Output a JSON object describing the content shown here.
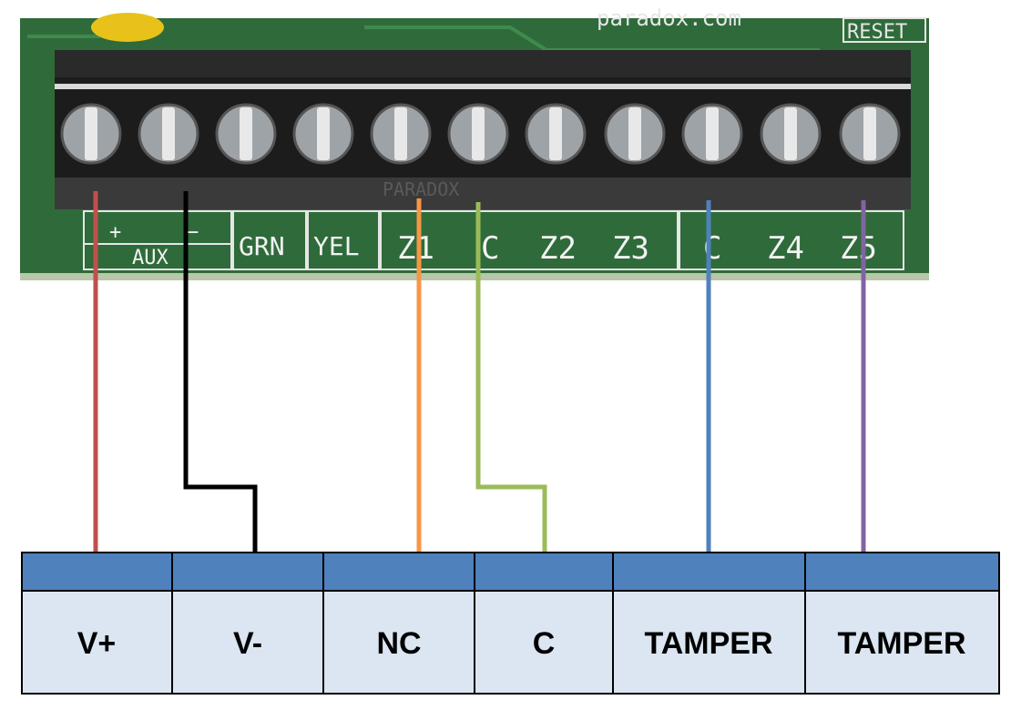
{
  "board": {
    "url_text": "paradox.com",
    "reset_text": "RESET",
    "brand_text": "PARADOX",
    "aux_text": "AUX",
    "aux_plus": "+",
    "aux_minus": "−",
    "terminal_labels": [
      "GRN",
      "YEL",
      "Z1",
      "C",
      "Z2",
      "Z3",
      "C",
      "Z4",
      "Z5"
    ],
    "colors": {
      "pcb": "#2f6b3a",
      "terminal_block": "#1c1c1c",
      "screw": "#9ea3a8"
    }
  },
  "wires": [
    {
      "name": "V+ wire",
      "color": "#c0504d"
    },
    {
      "name": "V- wire",
      "color": "#000000"
    },
    {
      "name": "NC wire",
      "color": "#f79646"
    },
    {
      "name": "C wire",
      "color": "#9bbb59"
    },
    {
      "name": "TAMPER wire 1",
      "color": "#4f81bd"
    },
    {
      "name": "TAMPER wire 2",
      "color": "#8064a2"
    }
  ],
  "device_table": {
    "header_color": "#4f81bd",
    "cell_color": "#dce6f2",
    "cells": [
      "V+",
      "V-",
      "NC",
      "C",
      "TAMPER",
      "TAMPER"
    ]
  }
}
